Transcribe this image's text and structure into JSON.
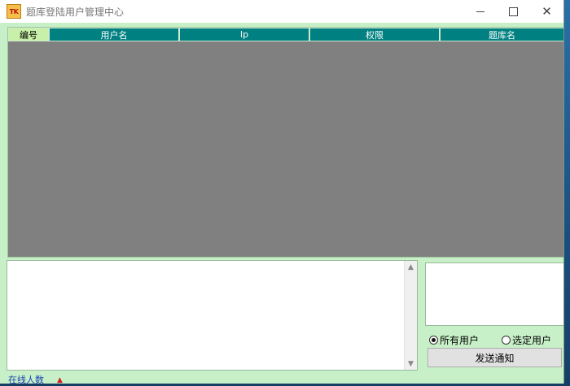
{
  "window": {
    "icon_text": "TK",
    "title": "题库登陆用户管理中心"
  },
  "grid": {
    "columns": [
      "编号",
      "用户名",
      "Ip",
      "权限",
      "题库名"
    ]
  },
  "notify": {
    "radio_all": "所有用户",
    "radio_selected": "选定用户",
    "selected_option": "all",
    "send_label": "发送通知"
  },
  "status": {
    "text": "在线人数"
  },
  "colors": {
    "header_bg": "#008080",
    "first_header_bg": "#c8f0a8",
    "grid_bg": "#808080",
    "window_bg": "#c8f0c8"
  }
}
